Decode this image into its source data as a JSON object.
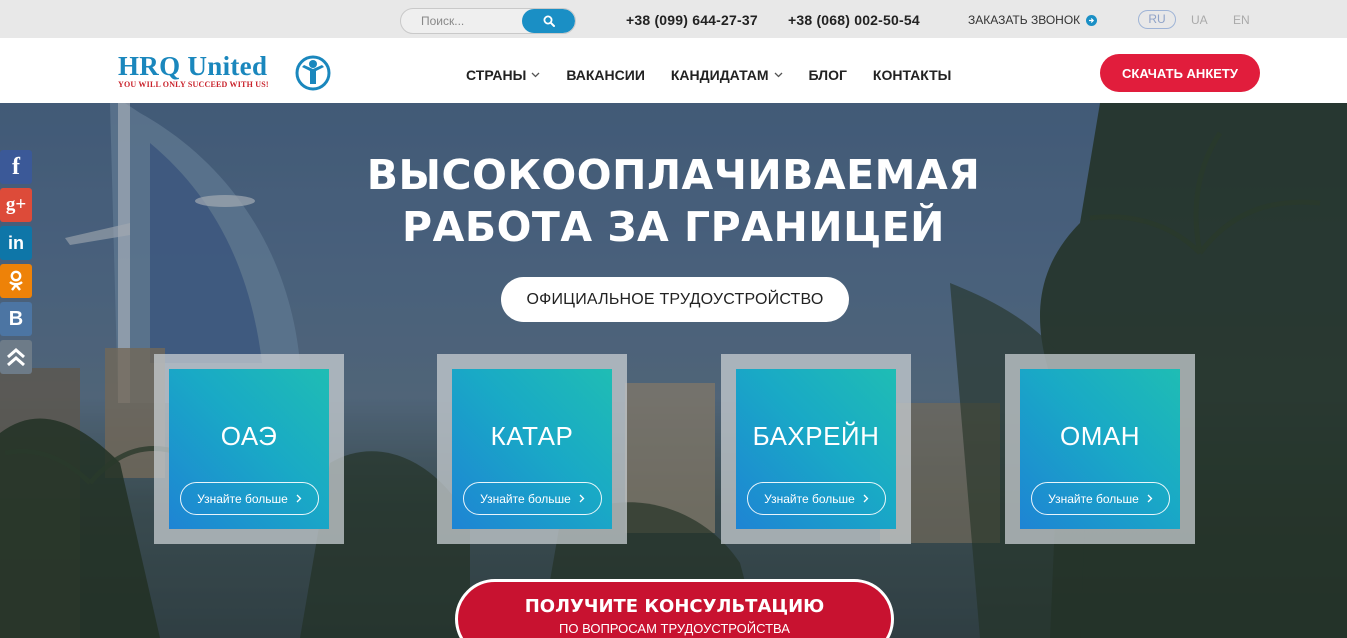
{
  "topbar": {
    "search_placeholder": "Поиск...",
    "phone1": "+38 (099) 644-27-37",
    "phone2": "+38 (068) 002-50-54",
    "callback": "ЗАКАЗАТЬ ЗВОНОК",
    "languages": [
      "RU",
      "UA",
      "EN"
    ],
    "active_language": "RU"
  },
  "header": {
    "logo_title": "HRQ United",
    "logo_tagline": "YOU WILL ONLY SUCCEED WITH US!",
    "nav": [
      {
        "label": "СТРАНЫ",
        "dropdown": true
      },
      {
        "label": "ВАКАНСИИ",
        "dropdown": false
      },
      {
        "label": "КАНДИДАТАМ",
        "dropdown": true
      },
      {
        "label": "БЛОГ",
        "dropdown": false
      },
      {
        "label": "КОНТАКТЫ",
        "dropdown": false
      }
    ],
    "cta": "СКАЧАТЬ АНКЕТУ"
  },
  "hero": {
    "title_line1": "ВЫСОКООПЛАЧИВАЕМАЯ",
    "title_line2": "РАБОТА ЗА ГРАНИЦЕЙ",
    "pill": "ОФИЦИАЛЬНОЕ ТРУДОУСТРОЙСТВО",
    "cards": [
      {
        "title": "ОАЭ",
        "button": "Узнайте больше"
      },
      {
        "title": "КАТАР",
        "button": "Узнайте больше"
      },
      {
        "title": "БАХРЕЙН",
        "button": "Узнайте больше"
      },
      {
        "title": "ОМАН",
        "button": "Узнайте больше"
      }
    ],
    "consult_main": "ПОЛУЧИТЕ КОНСУЛЬТАЦИЮ",
    "consult_sub": "ПО ВОПРОСАМ ТРУДОУСТРОЙСТВА"
  },
  "social": {
    "items": [
      {
        "name": "facebook",
        "glyph": "f",
        "color": "#3b5998"
      },
      {
        "name": "google-plus",
        "glyph": "g+",
        "color": "#dd4b39"
      },
      {
        "name": "linkedin",
        "glyph": "in",
        "color": "#0e76a8"
      },
      {
        "name": "odnoklassniki",
        "glyph": "ok",
        "color": "#ee8208"
      },
      {
        "name": "vkontakte",
        "glyph": "B",
        "color": "#4c75a3"
      },
      {
        "name": "scroll-up",
        "glyph": "^",
        "color": "#6d7b88"
      }
    ]
  },
  "colors": {
    "brand_blue": "#1a87bd",
    "accent_red": "#e11d3c",
    "card_gradient_start": "#1e84d4",
    "card_gradient_end": "#1fbdb4"
  }
}
